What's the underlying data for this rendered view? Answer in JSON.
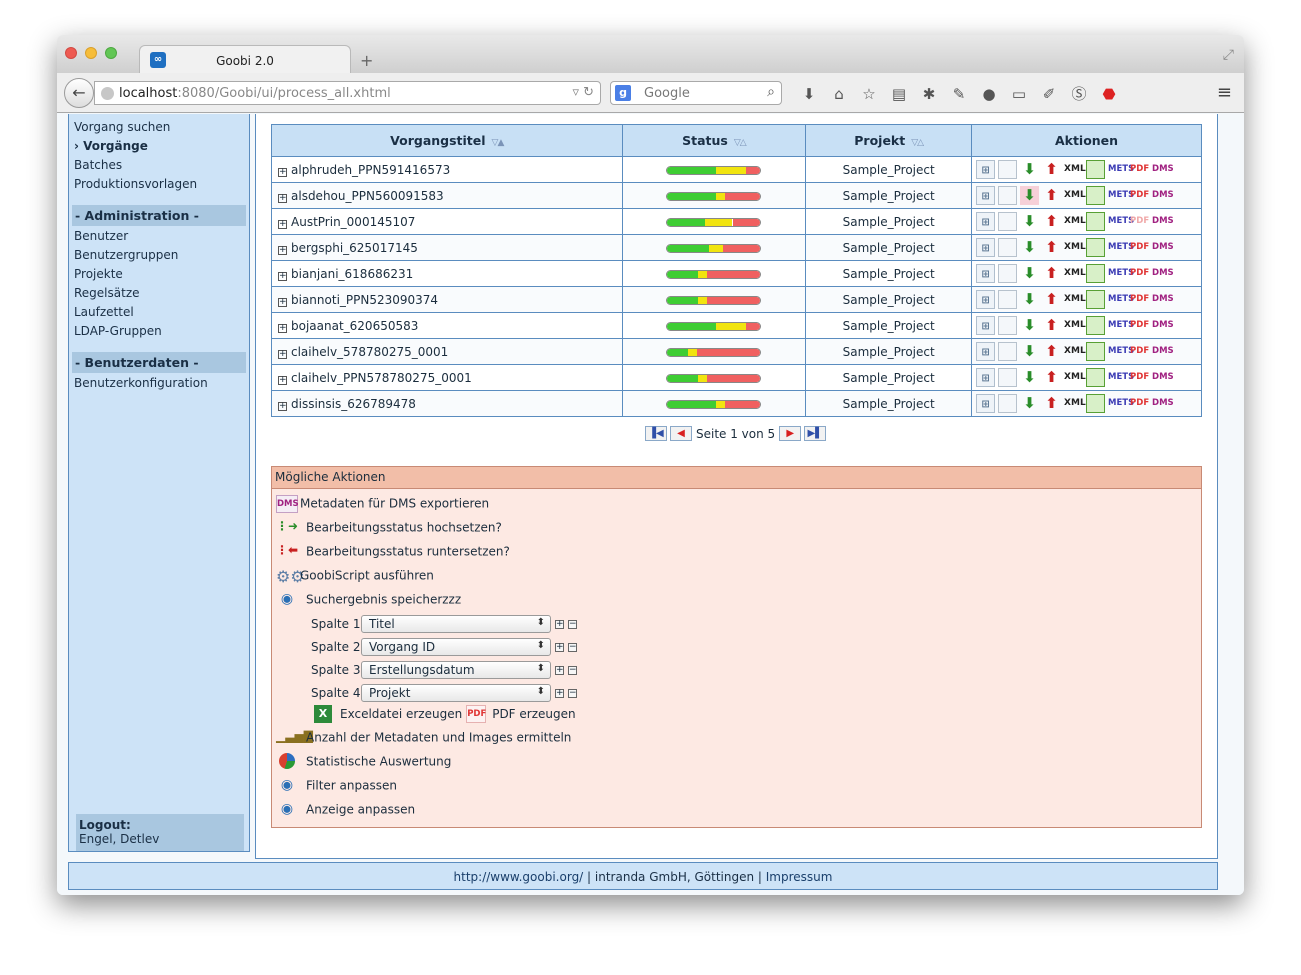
{
  "browser": {
    "tab_title": "Goobi 2.0",
    "new_tab": "+",
    "url_host": "localhost",
    "url_rest": ":8080/Goobi/ui/process_all.xhtml",
    "search_placeholder": "Google"
  },
  "sidebar": {
    "links_top": [
      "Vorgang suchen",
      "Vorgänge",
      "Batches",
      "Produktionsvorlagen"
    ],
    "current_marker": "›",
    "admin_header": "- Administration -",
    "admin_links": [
      "Benutzer",
      "Benutzergruppen",
      "Projekte",
      "Regelsätze",
      "Laufzettel",
      "LDAP-Gruppen"
    ],
    "user_header": "- Benutzerdaten -",
    "user_links": [
      "Benutzerkonfiguration"
    ],
    "logout_label": "Logout:",
    "logout_user": "Engel, Detlev"
  },
  "table": {
    "headers": {
      "title": "Vorgangstitel",
      "status": "Status",
      "project": "Projekt",
      "actions": "Aktionen"
    },
    "rows": [
      {
        "title": "alphrudeh_PPN591416573",
        "project": "Sample_Project",
        "status": [
          0.52,
          0.33,
          0.15
        ]
      },
      {
        "title": "alsdehou_PPN560091583",
        "project": "Sample_Project",
        "status": [
          0.52,
          0.1,
          0.38
        ]
      },
      {
        "title": "AustPrin_000145107",
        "project": "Sample_Project",
        "status": [
          0.4,
          0.3,
          0.3
        ]
      },
      {
        "title": "bergsphi_625017145",
        "project": "Sample_Project",
        "status": [
          0.45,
          0.15,
          0.4
        ]
      },
      {
        "title": "bianjani_618686231",
        "project": "Sample_Project",
        "status": [
          0.33,
          0.1,
          0.57
        ]
      },
      {
        "title": "biannoti_PPN523090374",
        "project": "Sample_Project",
        "status": [
          0.33,
          0.1,
          0.57
        ]
      },
      {
        "title": "bojaanat_620650583",
        "project": "Sample_Project",
        "status": [
          0.52,
          0.33,
          0.15
        ]
      },
      {
        "title": "claihelv_578780275_0001",
        "project": "Sample_Project",
        "status": [
          0.22,
          0.1,
          0.68
        ]
      },
      {
        "title": "claihelv_PPN578780275_0001",
        "project": "Sample_Project",
        "status": [
          0.33,
          0.1,
          0.57
        ]
      },
      {
        "title": "dissinsis_626789478",
        "project": "Sample_Project",
        "status": [
          0.52,
          0.1,
          0.38
        ]
      }
    ],
    "action_labels": {
      "xml": "XML",
      "mets": "METS",
      "pdf": "PDF",
      "dms": "DMS"
    }
  },
  "pager": {
    "text": "Seite 1 von 5"
  },
  "possible_actions": {
    "header": "Mögliche Aktionen",
    "dms_icon": "DMS",
    "export_dms": "Metadaten für DMS exportieren",
    "status_up": "Bearbeitungsstatus hochsetzen?",
    "status_down": "Bearbeitungsstatus runtersetzen?",
    "goobiscript": "GoobiScript ausführen",
    "save_search": "Suchergebnis speicherzzz",
    "columns": [
      {
        "label": "Spalte 1",
        "value": "Titel"
      },
      {
        "label": "Spalte 2",
        "value": "Vorgang ID"
      },
      {
        "label": "Spalte 3",
        "value": "Erstellungsdatum"
      },
      {
        "label": "Spalte 4",
        "value": "Projekt"
      }
    ],
    "excel": "Exceldatei erzeugen",
    "pdf_icon": "PDF",
    "pdf": "PDF erzeugen",
    "count_metadata": "Anzahl der Metadaten und Images ermitteln",
    "statistics": "Statistische Auswertung",
    "filter": "Filter anpassen",
    "display": "Anzeige anpassen"
  },
  "footer": {
    "link": "http://www.goobi.org/",
    "sep1": " | ",
    "company": "intranda GmbH, Göttingen",
    "sep2": " | ",
    "impressum": "Impressum"
  }
}
